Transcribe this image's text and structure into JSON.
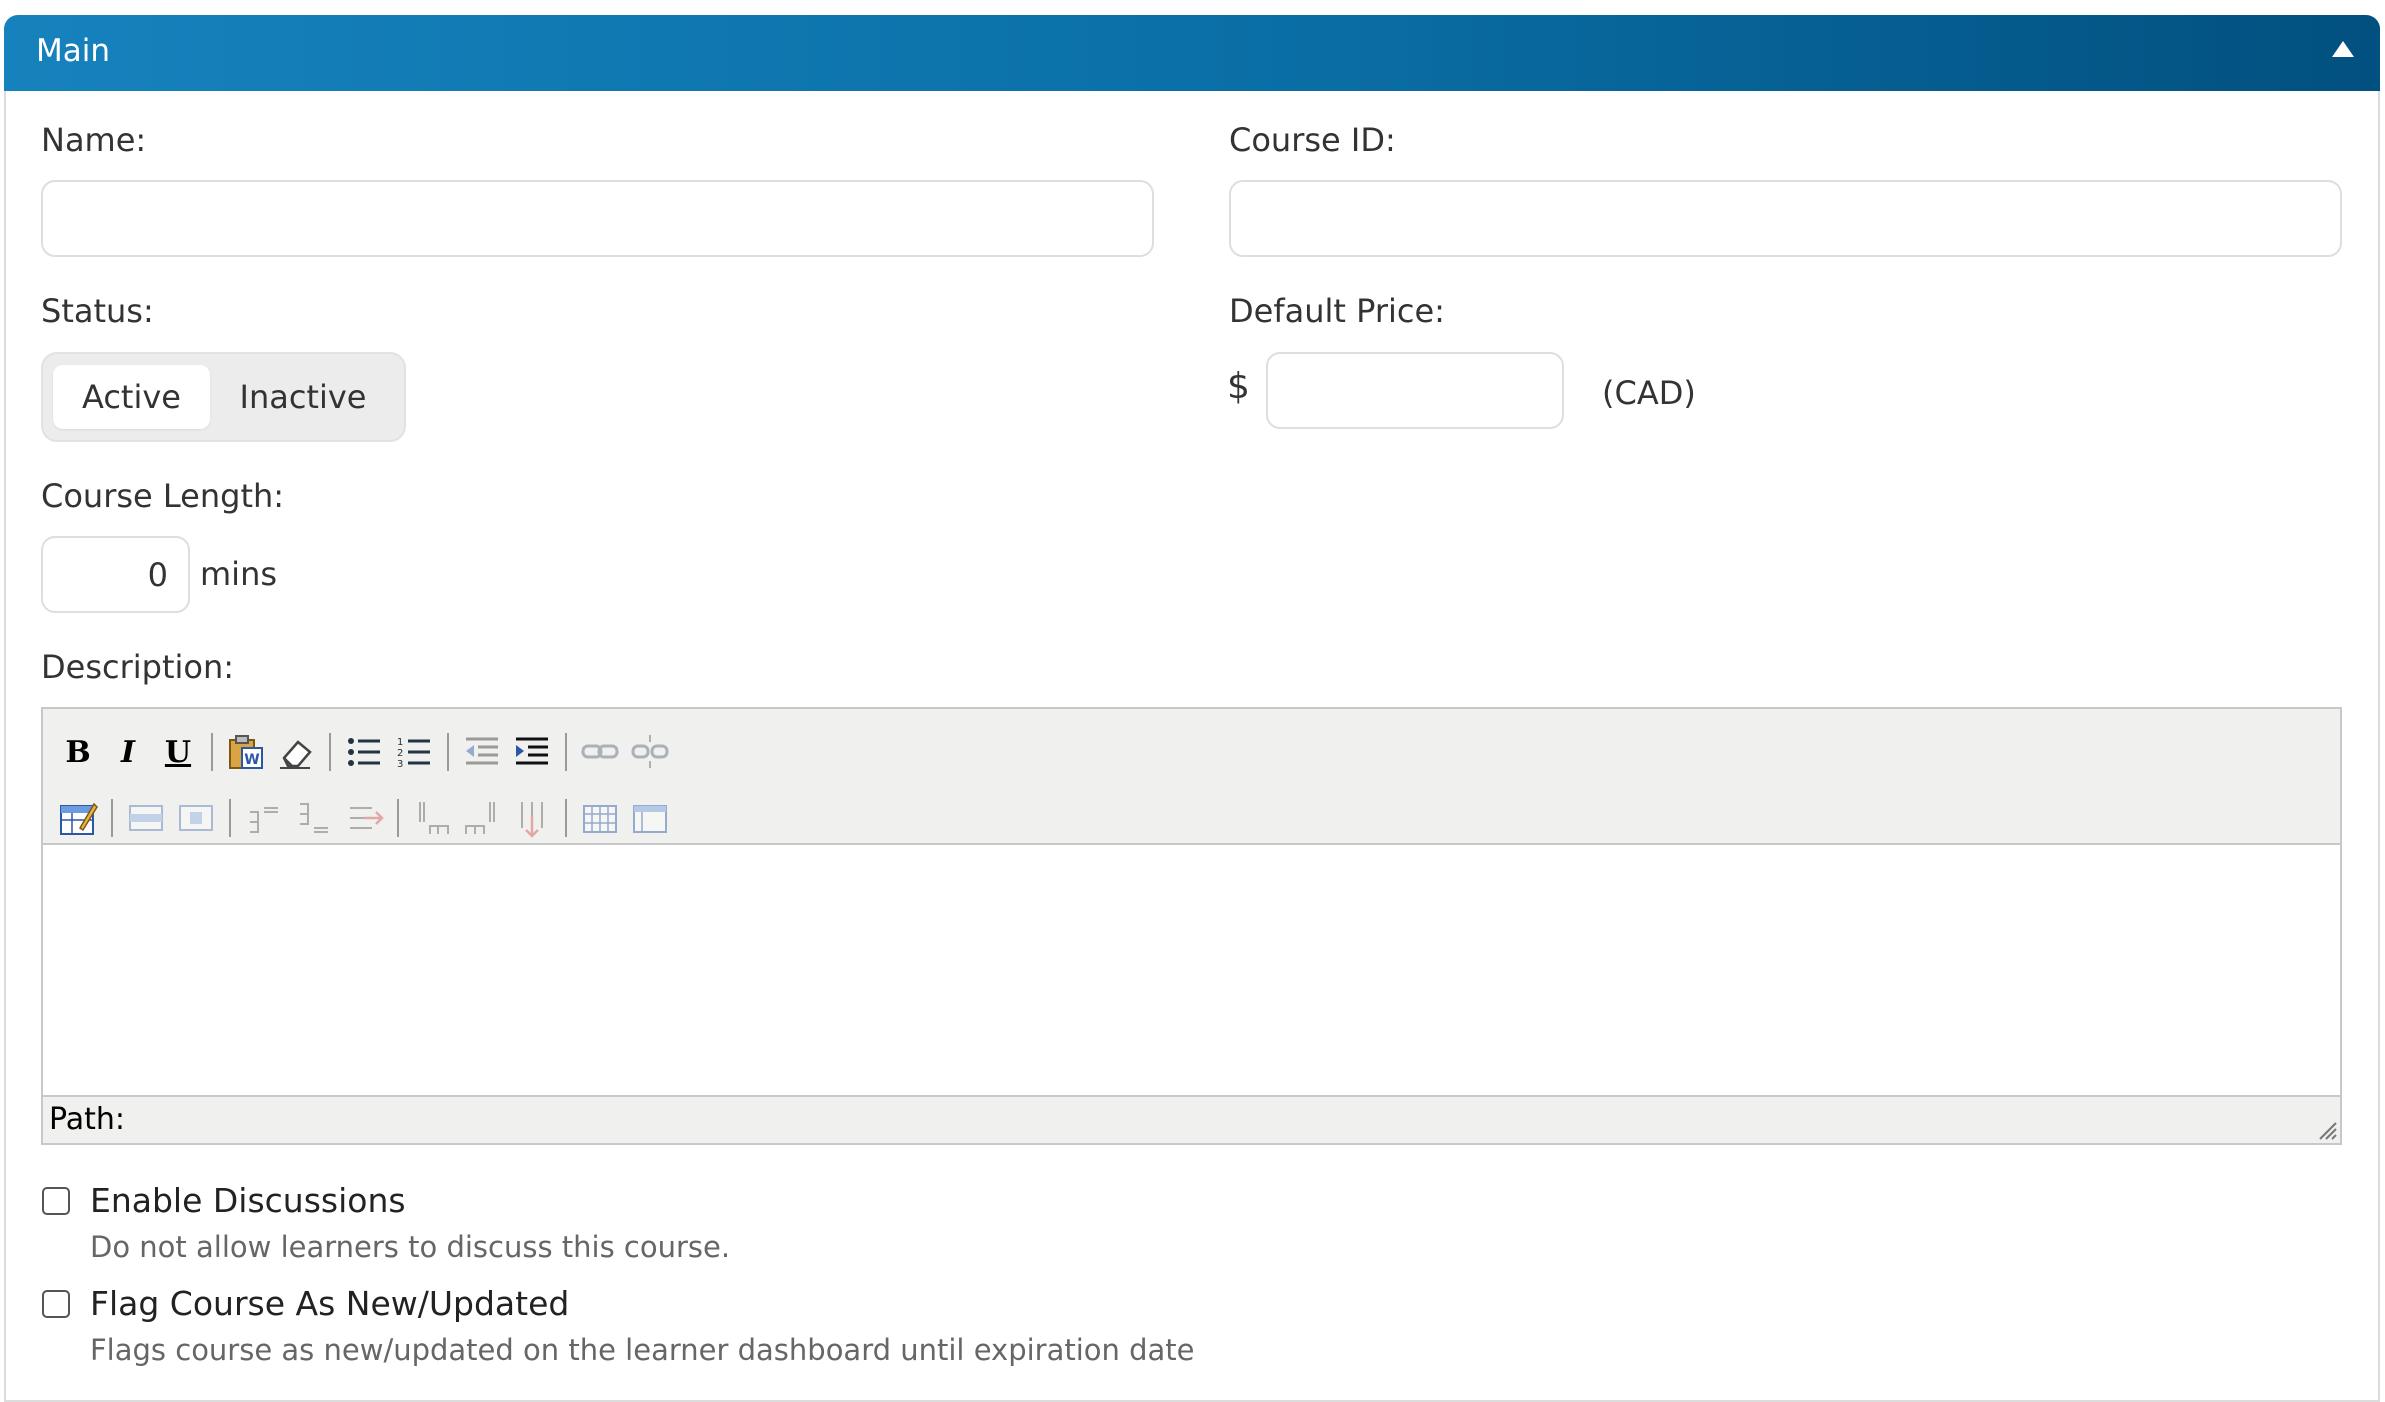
{
  "panel": {
    "title": "Main"
  },
  "fields": {
    "name": {
      "label": "Name:",
      "value": ""
    },
    "course_id": {
      "label": "Course ID:",
      "value": ""
    },
    "status": {
      "label": "Status:",
      "options": [
        "Active",
        "Inactive"
      ],
      "selected": "Active"
    },
    "default_price": {
      "label": "Default Price:",
      "currency_symbol": "$",
      "value": "",
      "currency": "(CAD)"
    },
    "course_length": {
      "label": "Course Length:",
      "value": "0",
      "unit": "mins"
    },
    "description": {
      "label": "Description:",
      "content": ""
    }
  },
  "editor": {
    "toolbar_row1": [
      "bold-button",
      "italic-button",
      "underline-button",
      "separator",
      "paste-word-button",
      "clean-formatting-button",
      "separator",
      "bullet-list-button",
      "numbered-list-button",
      "separator",
      "outdent-button",
      "indent-button",
      "separator",
      "link-button",
      "unlink-button"
    ],
    "toolbar_row2": [
      "table-button",
      "separator",
      "row-properties-button",
      "cell-properties-button",
      "separator",
      "insert-row-before-button",
      "insert-row-after-button",
      "delete-row-button",
      "separator",
      "insert-column-before-button",
      "insert-column-after-button",
      "delete-column-button",
      "separator",
      "split-cells-button",
      "merge-cells-button"
    ],
    "bold_glyph": "B",
    "italic_glyph": "I",
    "underline_glyph": "U",
    "path_label": "Path:"
  },
  "options": {
    "enable_discussions": {
      "label": "Enable Discussions",
      "help": "Do not allow learners to discuss this course.",
      "checked": false
    },
    "flag_new": {
      "label": "Flag Course As New/Updated",
      "help": "Flags course as new/updated on the learner dashboard until expiration date",
      "checked": false
    }
  },
  "colors": {
    "header_start": "#1682bd",
    "header_end": "#02507f"
  }
}
